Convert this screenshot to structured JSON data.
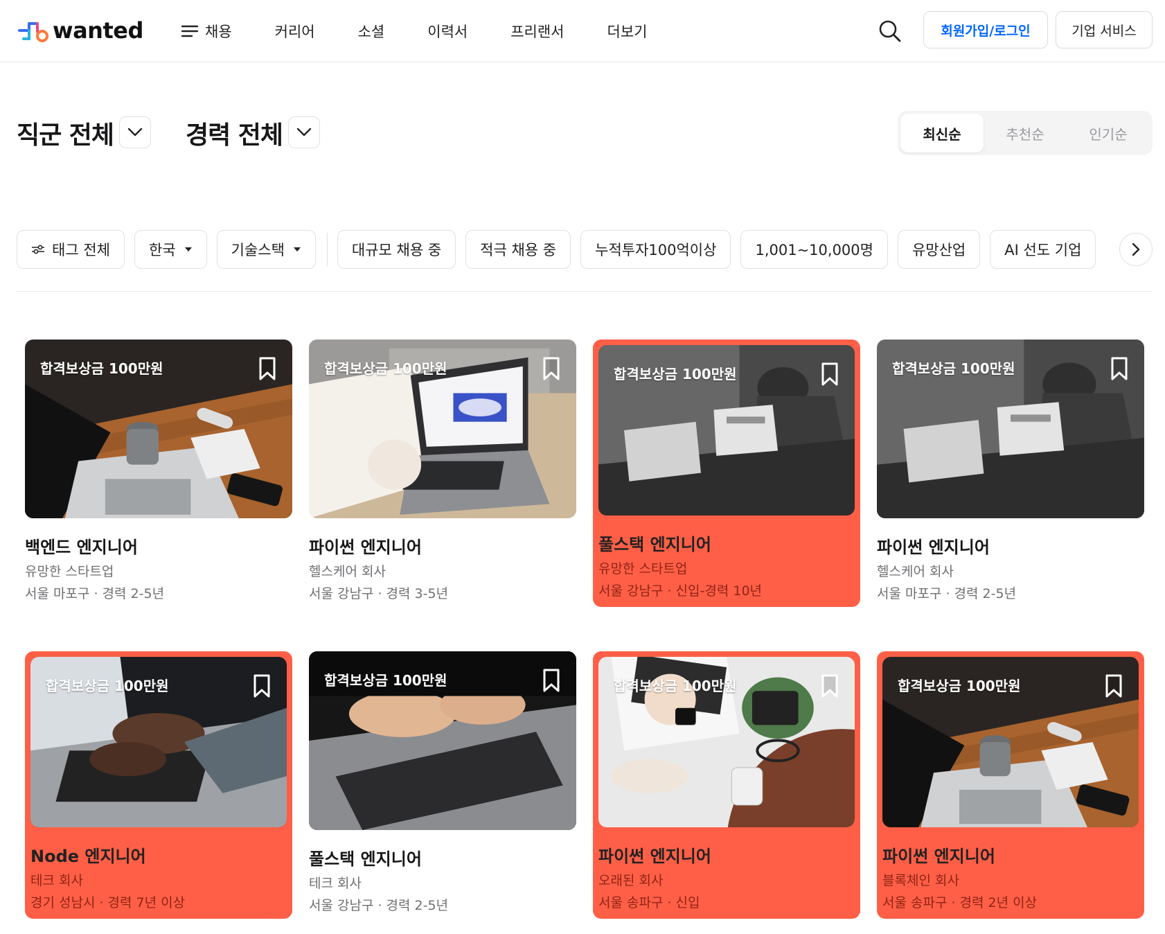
{
  "header": {
    "logo_text": "wanted",
    "nav": [
      "채용",
      "커리어",
      "소셜",
      "이력서",
      "프리랜서",
      "더보기"
    ],
    "login_label": "회원가입/로그인",
    "company_label": "기업 서비스"
  },
  "filters": {
    "job_category": "직군 전체",
    "experience": "경력 전체",
    "sort": [
      "최신순",
      "추천순",
      "인기순"
    ],
    "sort_active": "최신순"
  },
  "tags": [
    "태그 전체",
    "한국",
    "기술스택",
    "대규모 채용 중",
    "적극 채용 중",
    "누적투자100억이상",
    "1,001~10,000명",
    "유망산업",
    "AI 선도 기업"
  ],
  "jobs": [
    {
      "badge": "합격보상금 100만원",
      "title": "백엔드 엔지니어",
      "company": "유망한 스타트업",
      "meta": "서울 마포구 · 경력 2-5년",
      "highlighted": false
    },
    {
      "badge": "합격보상금 100만원",
      "title": "파이썬 엔지니어",
      "company": "헬스케어 회사",
      "meta": "서울 강남구 · 경력 3-5년",
      "highlighted": false
    },
    {
      "badge": "합격보상금 100만원",
      "title": "풀스택 엔지니어",
      "company": "유망한 스타트업",
      "meta": "서울 강남구 · 신입-경력 10년",
      "highlighted": true
    },
    {
      "badge": "합격보상금 100만원",
      "title": "파이썬 엔지니어",
      "company": "헬스케어 회사",
      "meta": "서울 마포구 · 경력 2-5년",
      "highlighted": false
    },
    {
      "badge": "합격보상금 100만원",
      "title": "Node 엔지니어",
      "company": "테크 회사",
      "meta": "경기 성남시 · 경력 7년 이상",
      "highlighted": true
    },
    {
      "badge": "합격보상금 100만원",
      "title": "풀스택 엔지니어",
      "company": "테크 회사",
      "meta": "서울 강남구 · 경력 2-5년",
      "highlighted": false
    },
    {
      "badge": "합격보상금 100만원",
      "title": "파이썬 엔지니어",
      "company": "오래된 회사",
      "meta": "서울 송파구 · 신입",
      "highlighted": true
    },
    {
      "badge": "합격보상금 100만원",
      "title": "파이썬 엔지니어",
      "company": "블록체인 회사",
      "meta": "서울 송파구 · 경력 2년 이상",
      "highlighted": true
    }
  ],
  "colors": {
    "accent": "#ff5f47",
    "primary_blue": "#0066ff"
  }
}
